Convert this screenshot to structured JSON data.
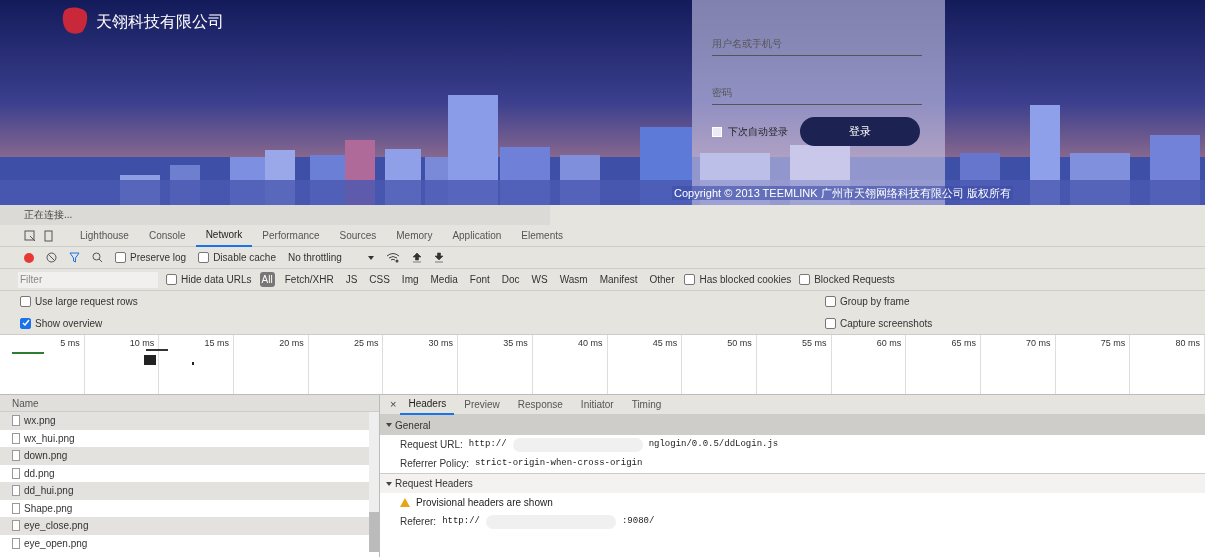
{
  "login_page": {
    "company_name": "天翎科技有限公司",
    "username": {
      "placeholder": "用户名或手机号"
    },
    "password": {
      "placeholder": "密码"
    },
    "remember": {
      "label": "下次自动登录",
      "checked": false
    },
    "login_button": "登录",
    "copyright": "Copyright © 2013 TEEMLINK 广州市天翎网络科技有限公司 版权所有"
  },
  "status_bar": "正在连接...",
  "devtools": {
    "tabs": [
      {
        "label": "Lighthouse",
        "selected": false
      },
      {
        "label": "Console",
        "selected": false
      },
      {
        "label": "Network",
        "selected": true
      },
      {
        "label": "Performance",
        "selected": false
      },
      {
        "label": "Sources",
        "selected": false
      },
      {
        "label": "Memory",
        "selected": false
      },
      {
        "label": "Application",
        "selected": false
      },
      {
        "label": "Elements",
        "selected": false
      }
    ],
    "toolbar": {
      "preserve_log": {
        "label": "Preserve log",
        "checked": false
      },
      "disable_cache": {
        "label": "Disable cache",
        "checked": false
      },
      "throttling": "No throttling"
    },
    "filter": {
      "placeholder": "Filter",
      "hide_data_urls": {
        "label": "Hide data URLs",
        "checked": false
      },
      "types": [
        {
          "label": "All",
          "selected": true
        },
        {
          "label": "Fetch/XHR",
          "selected": false
        },
        {
          "label": "JS",
          "selected": false
        },
        {
          "label": "CSS",
          "selected": false
        },
        {
          "label": "Img",
          "selected": false
        },
        {
          "label": "Media",
          "selected": false
        },
        {
          "label": "Font",
          "selected": false
        },
        {
          "label": "Doc",
          "selected": false
        },
        {
          "label": "WS",
          "selected": false
        },
        {
          "label": "Wasm",
          "selected": false
        },
        {
          "label": "Manifest",
          "selected": false
        },
        {
          "label": "Other",
          "selected": false
        }
      ],
      "has_blocked_cookies": {
        "label": "Has blocked cookies",
        "checked": false
      },
      "blocked_requests": {
        "label": "Blocked Requests",
        "checked": false
      }
    },
    "options_left": [
      {
        "label": "Use large request rows",
        "checked": false
      },
      {
        "label": "Show overview",
        "checked": true
      }
    ],
    "options_right": [
      {
        "label": "Group by frame",
        "checked": false
      },
      {
        "label": "Capture screenshots",
        "checked": false
      }
    ],
    "timeline": {
      "ticks": [
        "5 ms",
        "10 ms",
        "15 ms",
        "20 ms",
        "25 ms",
        "30 ms",
        "35 ms",
        "40 ms",
        "45 ms",
        "50 ms",
        "55 ms",
        "60 ms",
        "65 ms",
        "70 ms",
        "75 ms",
        "80 ms"
      ]
    },
    "requests": {
      "column": "Name",
      "rows": [
        {
          "name": "wx.png"
        },
        {
          "name": "wx_hui.png"
        },
        {
          "name": "down.png"
        },
        {
          "name": "dd.png"
        },
        {
          "name": "dd_hui.png"
        },
        {
          "name": "Shape.png"
        },
        {
          "name": "eye_close.png"
        },
        {
          "name": "eye_open.png"
        }
      ]
    },
    "details": {
      "close": "×",
      "tabs": [
        {
          "label": "Headers",
          "selected": true
        },
        {
          "label": "Preview",
          "selected": false
        },
        {
          "label": "Response",
          "selected": false
        },
        {
          "label": "Initiator",
          "selected": false
        },
        {
          "label": "Timing",
          "selected": false
        }
      ],
      "sections": [
        {
          "title": "General",
          "expanded": true,
          "rows": [
            {
              "kind": "field",
              "name": "Request URL:",
              "value": [
                "http://",
                "nglogin/0.0.5/ddLogin.js"
              ]
            },
            {
              "kind": "field",
              "name": "Referrer Policy:",
              "value": [
                "strict-origin-when-cross-origin"
              ]
            }
          ]
        },
        {
          "title": "Request Headers",
          "expanded": true,
          "rows": [
            {
              "kind": "warning",
              "text": "Provisional headers are shown"
            },
            {
              "kind": "field",
              "name": "Referer:",
              "value": [
                "http://",
                ":9080/"
              ]
            }
          ]
        }
      ]
    }
  }
}
